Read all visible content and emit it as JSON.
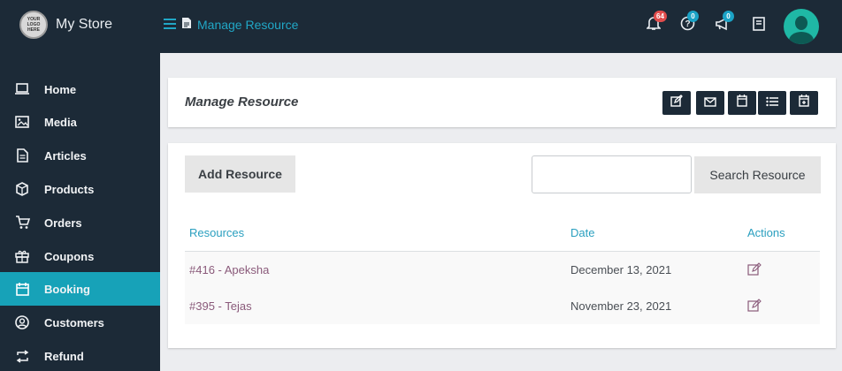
{
  "app": {
    "logo_text": "YOUR LOGO HERE",
    "brand": "My Store",
    "breadcrumb": "Manage Resource"
  },
  "topbar": {
    "notifications_badge": "64",
    "help_badge": "0",
    "announcements_badge": "0",
    "colors": {
      "badge_red": "#e04c4c",
      "badge_blue": "#1ba3c6",
      "accent": "#17a2b8"
    }
  },
  "sidebar": {
    "items": [
      {
        "label": "Home",
        "icon": "laptop-icon"
      },
      {
        "label": "Media",
        "icon": "image-icon"
      },
      {
        "label": "Articles",
        "icon": "file-icon"
      },
      {
        "label": "Products",
        "icon": "box-icon"
      },
      {
        "label": "Orders",
        "icon": "cart-icon"
      },
      {
        "label": "Coupons",
        "icon": "gift-icon"
      },
      {
        "label": "Booking",
        "icon": "calendar-icon",
        "active": true
      },
      {
        "label": "Customers",
        "icon": "user-circle-icon"
      },
      {
        "label": "Refund",
        "icon": "repeat-icon"
      }
    ]
  },
  "header_card": {
    "title": "Manage Resource",
    "actions": [
      "edit-icon",
      "mail-icon",
      "calendar-icon",
      "list-icon",
      "calendar-check-icon"
    ]
  },
  "main": {
    "add_button": "Add Resource",
    "search_placeholder": "",
    "search_button": "Search Resource",
    "table": {
      "columns": [
        "Resources",
        "Date",
        "Actions"
      ],
      "rows": [
        {
          "resource": "#416 - Apeksha",
          "date": "December 13, 2021"
        },
        {
          "resource": "#395 - Tejas",
          "date": "November 23, 2021"
        }
      ]
    }
  }
}
